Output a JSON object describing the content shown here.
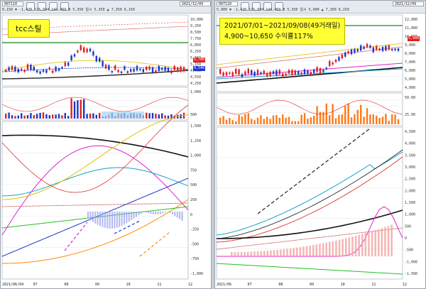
{
  "left_pane": {
    "stock_code": "007110",
    "toolbar_text": "6,150 ▼ -1,420  125,504  144,469  B 5,350  일시 5,350  ▲ 7,350  6,150",
    "date_field": "2021/12/09",
    "annotation": "tcc스틸",
    "price_axis": [
      "10,000",
      "9,250",
      "8,500",
      "7,750",
      "6,850",
      "6,250",
      "5,550",
      "5,150",
      "4,750",
      "4,550",
      "4,250"
    ],
    "osc_axis": [
      "1,500",
      "1,250",
      "1,000",
      "750",
      "500",
      "250",
      "0",
      "-250",
      "-500",
      "-750",
      "-1,000"
    ],
    "vol_axis": [
      "1,000",
      "500"
    ],
    "macd_axis": [
      "50.00",
      "25.00",
      "0.00"
    ],
    "dates": [
      "2021/06/04",
      "07",
      "08",
      "09",
      "10",
      "11",
      "12"
    ],
    "price_tags": [
      "6,150",
      "5,780",
      "4,540"
    ],
    "colors": {
      "up": "#e02020",
      "down": "#1a37c8",
      "ma_yellow": "#e1c200",
      "ma_green": "#1c8a1c",
      "bg": "#ffffff"
    }
  },
  "right_pane": {
    "stock_code": "007110",
    "toolbar_text": "5,900 ▼ -1,420  125,504  144,469  B 5,350  일시 5,900  ▲ 7,350  6,150",
    "date_field": "2021/12/09",
    "annotation_line1": "2021/07/01~2021/09/08(49거래일)",
    "annotation_line2": "4,900~10,650 수익률117%",
    "price_axis": [
      "12,000",
      "11,000",
      "10,000",
      "9,000",
      "8,000",
      "7,000",
      "6,000",
      "5,000",
      "4,000"
    ],
    "osc_axis": [
      "4,500",
      "4,000",
      "3,500",
      "3,000",
      "2,500",
      "2,000",
      "1,500",
      "1,000",
      "500",
      "0",
      "-500",
      "-1,000",
      "-1,500"
    ],
    "vol_axis": [
      "50.00",
      "25.00"
    ],
    "dates": [
      "2021/06",
      "07",
      "08",
      "09",
      "10",
      "11",
      "12"
    ],
    "price_tags": [
      "6,150",
      "5,900"
    ],
    "colors": {
      "up": "#e02020",
      "down": "#1a37c8",
      "vol": "#ff7a1a",
      "bg": "#ffffff"
    }
  }
}
